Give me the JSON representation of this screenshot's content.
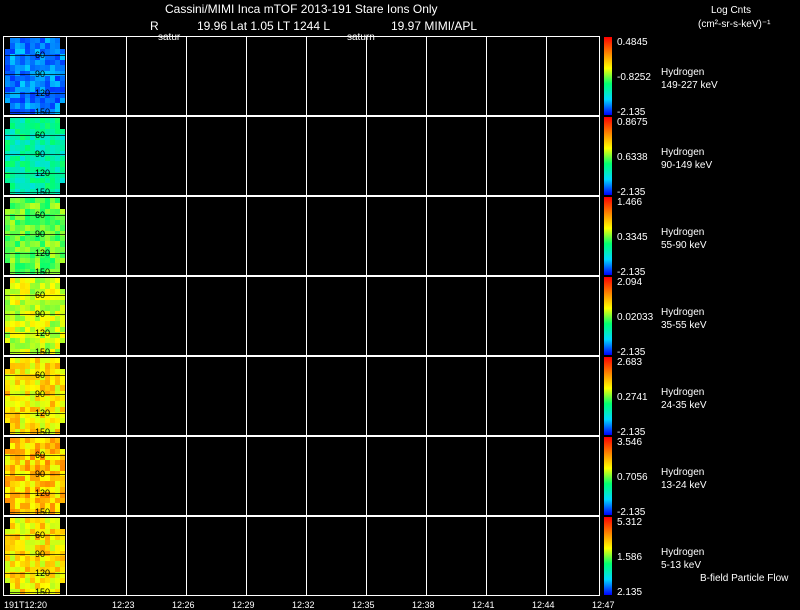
{
  "header": {
    "title": "Cassini/MIMI Inca mTOF  2013-191   Stare   Ions Only",
    "r_label": "R",
    "lat_lt": "19.96 Lat 1.05 LT 1244 L",
    "l_value": "19.97  MIMI/APL",
    "saturn_markers": [
      "satur",
      "saturn"
    ]
  },
  "units": {
    "line1": "Log Cnts",
    "line2": "(cm²-sr-s-keV)⁻¹"
  },
  "footer": {
    "flow_label": "B-field Particle Flow"
  },
  "chart_data": {
    "type": "heatmap",
    "time_ticks": [
      "191T12:20",
      "12:23",
      "12:26",
      "12:29",
      "12:32",
      "12:35",
      "12:38",
      "12:41",
      "12:44",
      "12:47"
    ],
    "angle_ticks": [
      "60",
      "90",
      "120",
      "150"
    ],
    "panels": [
      {
        "species": "Hydrogen",
        "energy": "149-227 keV",
        "cbar_max": "0.4845",
        "cbar_mid": "-0.8252",
        "cbar_min": "-2.135",
        "level": 0.15
      },
      {
        "species": "Hydrogen",
        "energy": "90-149 keV",
        "cbar_max": "0.8675",
        "cbar_mid": "0.6338",
        "cbar_min": "-2.135",
        "level": 0.38
      },
      {
        "species": "Hydrogen",
        "energy": "55-90 keV",
        "cbar_max": "1.466",
        "cbar_mid": "0.3345",
        "cbar_min": "-2.135",
        "level": 0.55
      },
      {
        "species": "Hydrogen",
        "energy": "35-55 keV",
        "cbar_max": "2.094",
        "cbar_mid": "0.02033",
        "cbar_min": "-2.135",
        "level": 0.65
      },
      {
        "species": "Hydrogen",
        "energy": "24-35 keV",
        "cbar_max": "2.683",
        "cbar_mid": "0.2741",
        "cbar_min": "-2.135",
        "level": 0.72
      },
      {
        "species": "Hydrogen",
        "energy": "13-24 keV",
        "cbar_max": "3.546",
        "cbar_mid": "0.7056",
        "cbar_min": "-2.135",
        "level": 0.76
      },
      {
        "species": "Hydrogen",
        "energy": "5-13 keV",
        "cbar_max": "5.312",
        "cbar_mid": "1.586",
        "cbar_min": "2.135",
        "level": 0.72
      }
    ]
  }
}
